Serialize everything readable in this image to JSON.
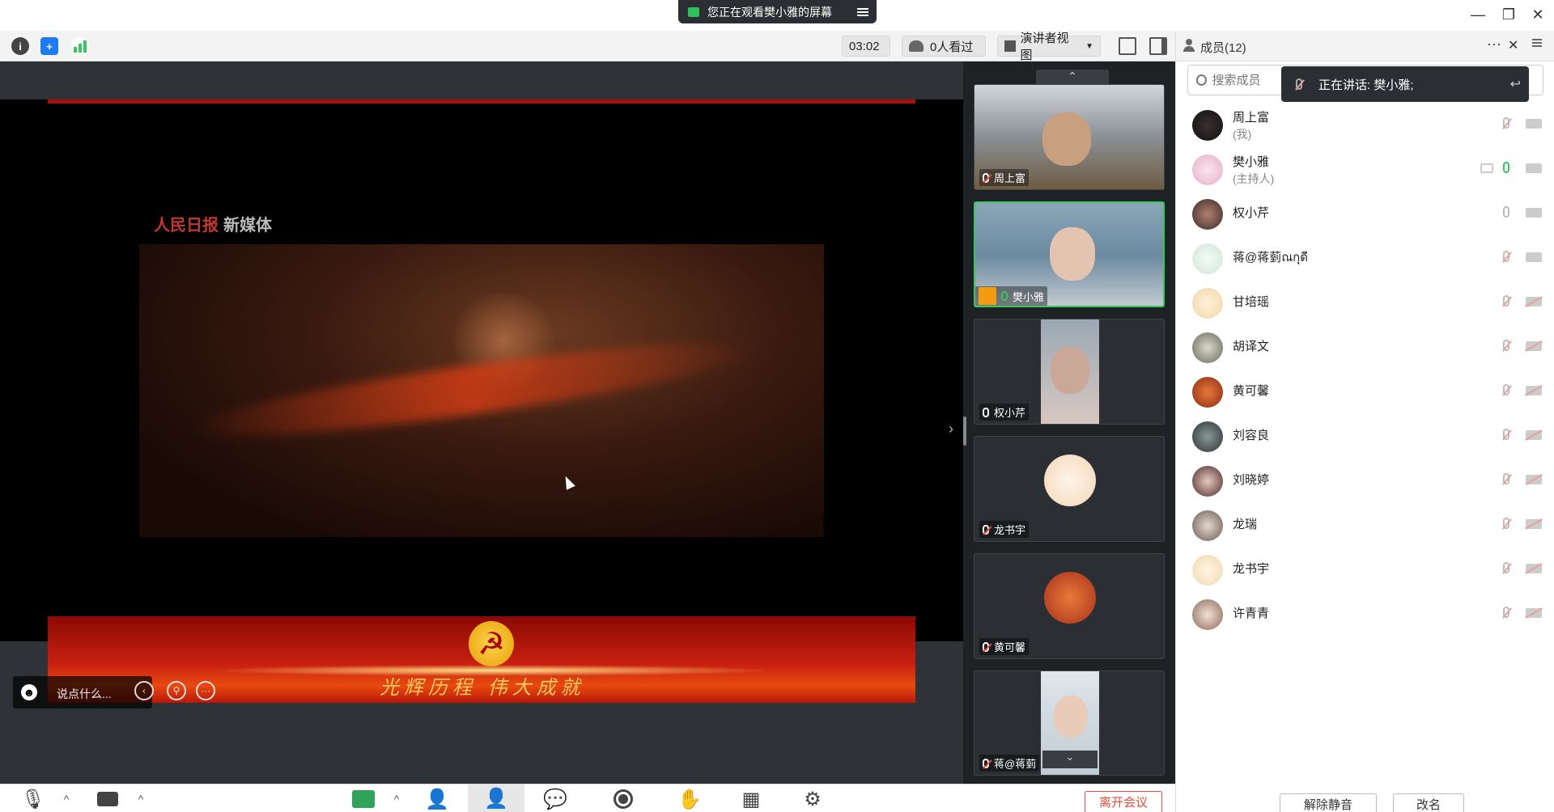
{
  "window": {
    "share_banner": "您正在观看樊小雅的屏幕",
    "controls": {
      "minimize": "—",
      "restore": "❐",
      "close": "✕"
    }
  },
  "toolbar": {
    "timer": "03:02",
    "viewers": "0人看过",
    "view_mode": "演讲者视图"
  },
  "content": {
    "brand_left": "人民日报",
    "brand_right": "新媒体",
    "slogan": "光辉历程 伟大成就"
  },
  "chat_overlay": {
    "placeholder": "说点什么..."
  },
  "thumbnails": [
    {
      "name": "周上富",
      "mic": "muted"
    },
    {
      "name": "樊小雅",
      "mic": "on",
      "host": true
    },
    {
      "name": "权小芹",
      "mic": "off"
    },
    {
      "name": "龙书宇",
      "mic": "muted"
    },
    {
      "name": "黄可馨",
      "mic": "muted"
    },
    {
      "name": "蒋@蒋菿",
      "mic": "muted"
    }
  ],
  "members_panel": {
    "title": "成员(12)",
    "search_placeholder": "搜索成员",
    "speaking": "正在讲话: 樊小雅;",
    "members": [
      {
        "name": "周上富",
        "sub": "(我)"
      },
      {
        "name": "樊小雅",
        "sub": "(主持人)"
      },
      {
        "name": "权小芹",
        "sub": ""
      },
      {
        "name": "蒋@蒋菿ณกุดี",
        "sub": ""
      },
      {
        "name": "甘培瑶",
        "sub": ""
      },
      {
        "name": "胡译文",
        "sub": ""
      },
      {
        "name": "黄可馨",
        "sub": ""
      },
      {
        "name": "刘容良",
        "sub": ""
      },
      {
        "name": "刘晓婷",
        "sub": ""
      },
      {
        "name": "龙瑞",
        "sub": ""
      },
      {
        "name": "龙书宇",
        "sub": ""
      },
      {
        "name": "许青青",
        "sub": ""
      }
    ],
    "unmute_all": "解除静音",
    "rename": "改名"
  },
  "bottom": {
    "leave": "离开会议"
  },
  "colors": {
    "accent_green": "#35c95b",
    "leave_red": "#e74c3c",
    "stage_bg": "#2f3337"
  }
}
